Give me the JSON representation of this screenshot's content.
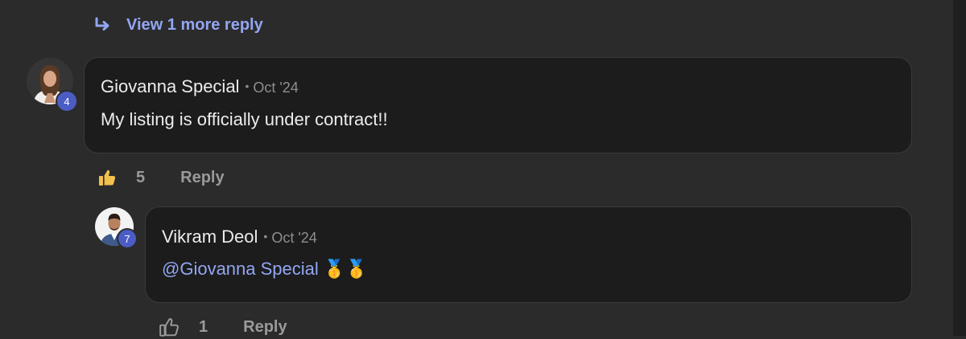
{
  "thread": {
    "view_more_label": "View 1 more reply"
  },
  "comments": [
    {
      "author": "Giovanna Special",
      "separator": "•",
      "date": "Oct '24",
      "body": "My listing is officially under contract!!",
      "level": "4",
      "likes": "5",
      "liked": true,
      "reply_label": "Reply"
    },
    {
      "author": "Vikram Deol",
      "separator": "•",
      "date": "Oct '24",
      "mention": "@Giovanna Special",
      "emoji": "🥇🥇",
      "level": "7",
      "likes": "1",
      "liked": false,
      "reply_label": "Reply"
    }
  ],
  "colors": {
    "background": "#2b2b2b",
    "bubble": "#1c1c1c",
    "link": "#93a6f2",
    "level_badge": "#4b5cc4",
    "like_active": "#f2c14e"
  },
  "icons": {
    "view_more": "reply-arrow-icon",
    "like_active": "thumbs-up-filled-icon",
    "like_inactive": "thumbs-up-outline-icon"
  }
}
